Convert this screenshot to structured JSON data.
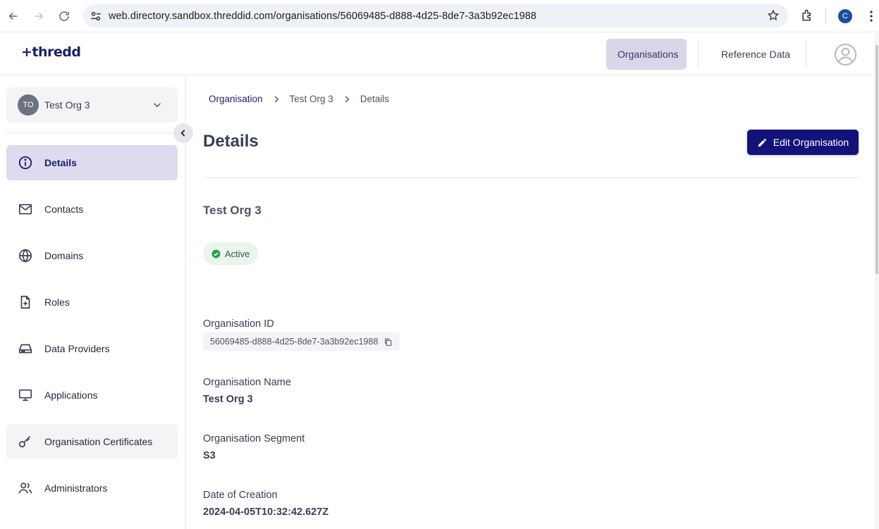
{
  "browser": {
    "url": "web.directory.sandbox.threddid.com/organisations/56069485-d888-4d25-8de7-3a3b92ec1988",
    "profile_initial": "C"
  },
  "header": {
    "logo": "+thredd",
    "nav": [
      {
        "label": "Organisations",
        "active": true
      },
      {
        "label": "Reference Data",
        "active": false
      }
    ]
  },
  "sidebar": {
    "org_select": {
      "initials": "TO",
      "name": "Test Org 3"
    },
    "items": [
      {
        "label": "Details",
        "icon": "info-icon",
        "active": true
      },
      {
        "label": "Contacts",
        "icon": "mail-icon"
      },
      {
        "label": "Domains",
        "icon": "globe-icon"
      },
      {
        "label": "Roles",
        "icon": "file-plus-icon"
      },
      {
        "label": "Data Providers",
        "icon": "storage-icon"
      },
      {
        "label": "Applications",
        "icon": "monitor-icon"
      },
      {
        "label": "Organisation Certificates",
        "icon": "key-icon",
        "hover": true
      },
      {
        "label": "Administrators",
        "icon": "users-icon"
      }
    ]
  },
  "main": {
    "breadcrumb": [
      "Organisation",
      "Test Org 3",
      "Details"
    ],
    "title": "Details",
    "edit_button": "Edit Organisation",
    "org_name_heading": "Test Org 3",
    "status": "Active",
    "fields": {
      "org_id_label": "Organisation ID",
      "org_id_value": "56069485-d888-4d25-8de7-3a3b92ec1988",
      "org_name_label": "Organisation Name",
      "org_name_value": "Test Org 3",
      "segment_label": "Organisation Segment",
      "segment_value": "S3",
      "created_label": "Date of Creation",
      "created_value": "2024-04-05T10:32:42.627Z"
    }
  },
  "colors": {
    "brand_navy": "#12127a",
    "active_nav_bg": "#d9d6e9",
    "status_green": "#2e9e4f"
  }
}
